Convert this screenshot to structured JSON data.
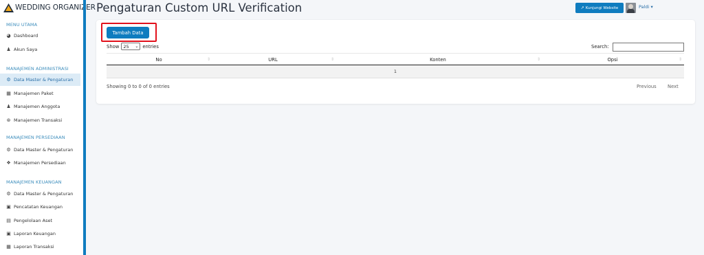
{
  "brand": {
    "name": "WEDDING ORGANIZER"
  },
  "sidebar": {
    "sections": [
      {
        "header": "MENU UTAMA",
        "items": [
          {
            "label": "Dashboard",
            "icon": "dashboard-icon"
          },
          {
            "label": "Akun Saya",
            "icon": "user-icon"
          }
        ]
      },
      {
        "header": "MANAJEMEN ADMINISTRASI",
        "items": [
          {
            "label": "Data Master & Pengaturan",
            "icon": "cogs-icon",
            "active": true
          },
          {
            "label": "Manajemen Paket",
            "icon": "book-icon"
          },
          {
            "label": "Manajemen Anggota",
            "icon": "users-icon"
          },
          {
            "label": "Manajemen Transaksi",
            "icon": "cart-icon"
          }
        ]
      },
      {
        "header": "MANAJEMEN PERSEDIAAN",
        "items": [
          {
            "label": "Data Master & Pengaturan",
            "icon": "cogs-icon"
          },
          {
            "label": "Manajemen Persediaan",
            "icon": "cubes-icon"
          }
        ]
      },
      {
        "header": "MANAJEMEN KEUANGAN",
        "items": [
          {
            "label": "Data Master & Pengaturan",
            "icon": "cogs-icon"
          },
          {
            "label": "Pencatatan Keuangan",
            "icon": "money-icon"
          },
          {
            "label": "Pengelolaan Aset",
            "icon": "hdd-icon"
          },
          {
            "label": "Laporan Keuangan",
            "icon": "money-icon"
          },
          {
            "label": "Laporan Transaksi",
            "icon": "book-icon"
          }
        ]
      }
    ]
  },
  "header": {
    "title": "Pengaturan Custom URL Verification",
    "visit_label": "Kunjungi Website",
    "user_name": "Paldi"
  },
  "content": {
    "add_button": "Tambah Data",
    "show_prefix": "Show",
    "page_size": "25",
    "show_suffix": "entries",
    "search_label": "Search:",
    "search_value": "",
    "columns": [
      "No",
      "URL",
      "Konten",
      "Opsi"
    ],
    "row_value": "1",
    "info": "Showing 0 to 0 of 0 entries",
    "prev_label": "Previous",
    "next_label": "Next"
  },
  "colors": {
    "accent": "#0f7cbf",
    "highlight": "#e2101b",
    "active_bg": "#dcebf6"
  }
}
